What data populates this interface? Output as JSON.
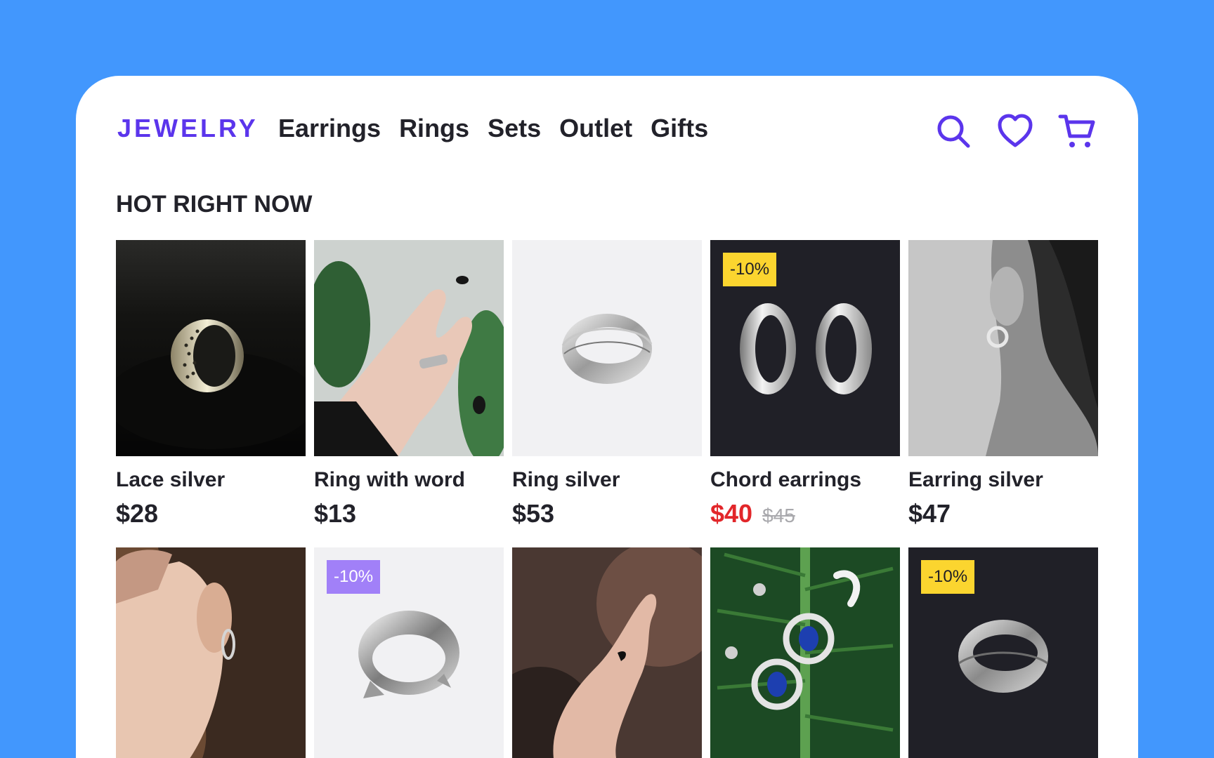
{
  "header": {
    "logo": "JEWELRY",
    "nav": [
      "Earrings",
      "Rings",
      "Sets",
      "Outlet",
      "Gifts"
    ],
    "icons": [
      "search-icon",
      "heart-icon",
      "cart-icon"
    ],
    "accent": "#5b35ec"
  },
  "section": {
    "title": "HOT RIGHT NOW"
  },
  "products": [
    {
      "name": "Lace silver",
      "price": "$28",
      "old_price": "",
      "badge": ""
    },
    {
      "name": "Ring with word",
      "price": "$13",
      "old_price": "",
      "badge": ""
    },
    {
      "name": "Ring silver",
      "price": "$53",
      "old_price": "",
      "badge": ""
    },
    {
      "name": "Chord earrings",
      "price": "$40",
      "old_price": "$45",
      "badge": "-10%"
    },
    {
      "name": "Earring silver",
      "price": "$47",
      "old_price": "",
      "badge": ""
    },
    {
      "name": "",
      "price": "",
      "old_price": "",
      "badge": ""
    },
    {
      "name": "",
      "price": "",
      "old_price": "",
      "badge": "-10%"
    },
    {
      "name": "",
      "price": "",
      "old_price": "",
      "badge": ""
    },
    {
      "name": "",
      "price": "",
      "old_price": "",
      "badge": ""
    },
    {
      "name": "",
      "price": "",
      "old_price": "",
      "badge": "-10%"
    }
  ],
  "colors": {
    "background": "#4297fd",
    "sale_price": "#e2262a",
    "badge_yellow": "#fbd52f",
    "badge_purple": "#a180f8"
  }
}
